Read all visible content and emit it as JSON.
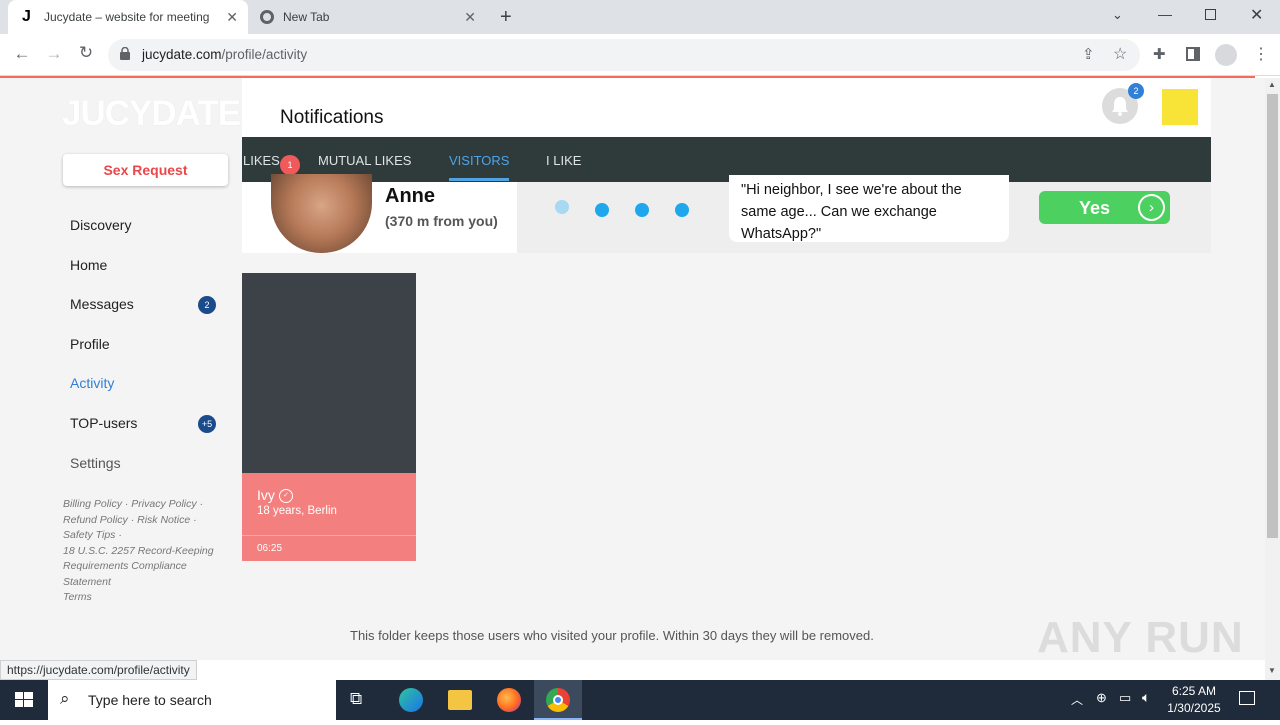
{
  "browser": {
    "tabs": [
      {
        "title": "Jucydate – website for meeting",
        "active": true
      },
      {
        "title": "New Tab",
        "active": false
      }
    ],
    "url_domain": "jucydate.com",
    "url_path": "/profile/activity",
    "status_url": "https://jucydate.com/profile/activity"
  },
  "site": {
    "logo": "JUCYDATE",
    "sex_request_label": "Sex Request",
    "nav": [
      {
        "label": "Discovery",
        "badge": ""
      },
      {
        "label": "Home",
        "badge": ""
      },
      {
        "label": "Messages",
        "badge": "2"
      },
      {
        "label": "Profile",
        "badge": ""
      },
      {
        "label": "Activity",
        "badge": ""
      },
      {
        "label": "TOP-users",
        "badge": "+5"
      },
      {
        "label": "Settings",
        "badge": ""
      }
    ],
    "footer_links": {
      "line1": "Billing Policy · Privacy Policy ·",
      "line2": "Refund Policy · Risk Notice ·",
      "line3": "Safety Tips ·",
      "line4": "18 U.S.C. 2257 Record-Keeping",
      "line5": "Requirements Compliance",
      "line6": "Statement",
      "line7": "Terms"
    },
    "accent_color": "#2f80d6",
    "brand_color": "#e8484a"
  },
  "header": {
    "title": "Notifications",
    "bell_badge": "2"
  },
  "activity_tabs": {
    "likes": "LIKES",
    "likes_badge": "1",
    "mutual": "MUTUAL LIKES",
    "visitors": "VISITORS",
    "ilike": "I LIKE"
  },
  "banner": {
    "name": "Anne",
    "distance": "(370 m from you)",
    "message": "\"Hi neighbor, I see we're about the same age... Can we exchange WhatsApp?\"",
    "yes_label": "Yes"
  },
  "visitor_card": {
    "name": "Ivy",
    "details": "18 years, Berlin",
    "time": "06:25"
  },
  "info_text": "This folder keeps those users who visited your profile. Within 30 days they will be removed.",
  "watermark": "ANY RUN",
  "taskbar": {
    "search_placeholder": "Type here to search",
    "time": "6:25 AM",
    "date": "1/30/2025"
  }
}
